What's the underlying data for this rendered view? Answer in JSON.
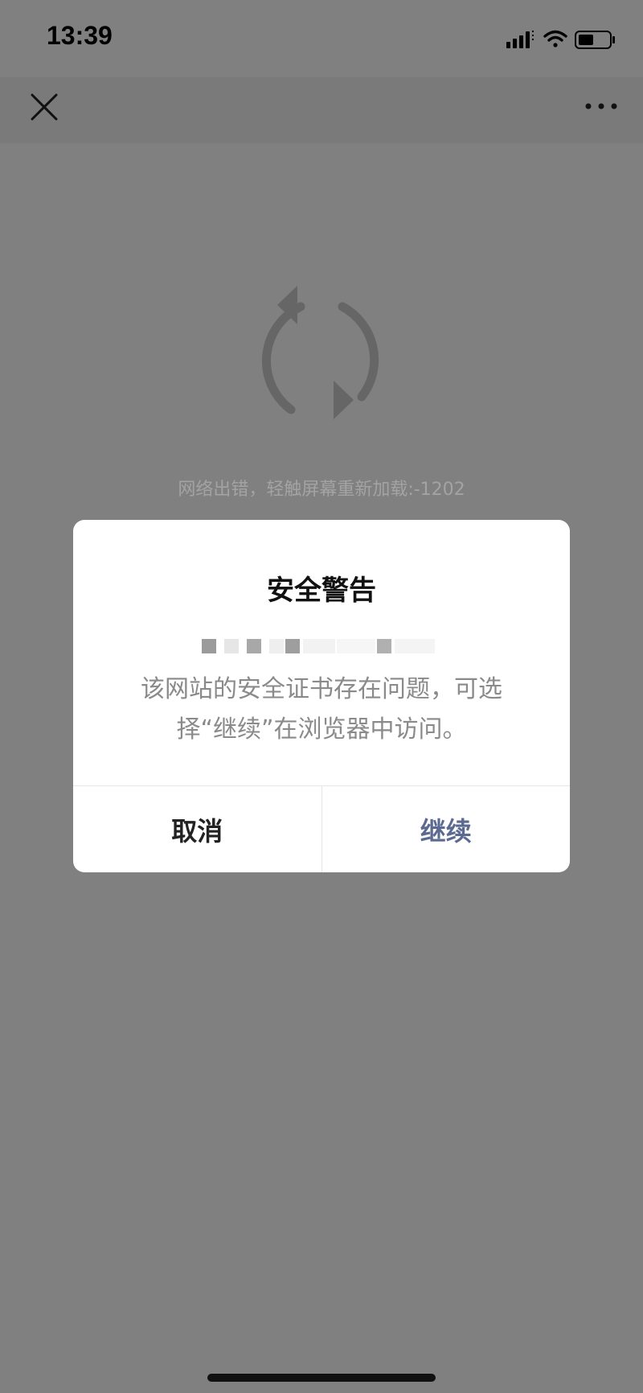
{
  "status_bar": {
    "time": "13:39",
    "icons": [
      "signal-icon",
      "wifi-icon",
      "battery-icon"
    ]
  },
  "nav_bar": {
    "close_icon": "close-icon",
    "more_icon": "more-icon"
  },
  "page": {
    "error_text": "网络出错，轻触屏幕重新加载:-1202",
    "reload_icon": "reload-icon"
  },
  "dialog": {
    "title": "安全警告",
    "message": "该网站的安全证书存在问题，可选择“继续”在浏览器中访问。",
    "cancel_label": "取消",
    "continue_label": "继续"
  },
  "colors": {
    "background": "#808080",
    "accent": "#5b6a91"
  }
}
